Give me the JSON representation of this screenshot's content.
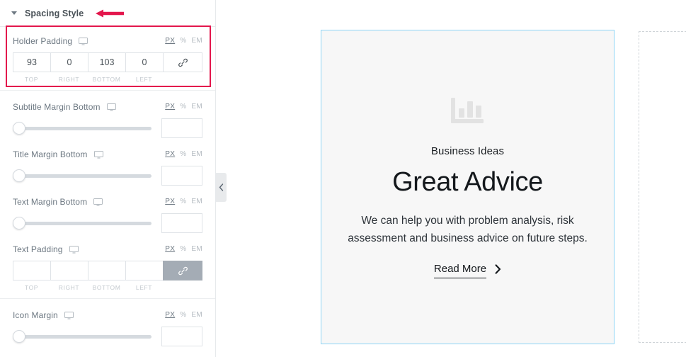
{
  "panel": {
    "title": "Spacing Style",
    "caret_icon": "caret-down-icon",
    "annotation_icon": "left-arrow-annotation-icon",
    "highlight_color": "#e3164c"
  },
  "units": {
    "px": "PX",
    "percent": "%",
    "em": "EM"
  },
  "dimension_labels": {
    "top": "TOP",
    "right": "RIGHT",
    "bottom": "BOTTOM",
    "left": "LEFT"
  },
  "controls": [
    {
      "label": "Holder Padding",
      "type": "dimensions",
      "device_icon": "desktop-monitor-icon",
      "active_unit": "PX",
      "highlighted": true,
      "link_active": false,
      "link_icon": "link-chain-icon",
      "values": {
        "top": "93",
        "right": "0",
        "bottom": "103",
        "left": "0"
      }
    },
    {
      "label": "Subtitle Margin Bottom",
      "type": "slider",
      "device_icon": "desktop-monitor-icon",
      "active_unit": "PX",
      "value": "",
      "slider_percent": 0
    },
    {
      "label": "Title Margin Bottom",
      "type": "slider",
      "device_icon": "desktop-monitor-icon",
      "active_unit": "PX",
      "value": "",
      "slider_percent": 0
    },
    {
      "label": "Text Margin Bottom",
      "type": "slider",
      "device_icon": "desktop-monitor-icon",
      "active_unit": "PX",
      "value": "",
      "slider_percent": 0
    },
    {
      "label": "Text Padding",
      "type": "dimensions",
      "device_icon": "desktop-monitor-icon",
      "active_unit": "PX",
      "highlighted": false,
      "link_active": true,
      "link_icon": "link-chain-icon",
      "values": {
        "top": "",
        "right": "",
        "bottom": "",
        "left": ""
      }
    },
    {
      "label": "Icon Margin",
      "type": "slider",
      "device_icon": "desktop-monitor-icon",
      "active_unit": "PX",
      "value": "",
      "slider_percent": 0
    }
  ],
  "collapse_tab": {
    "icon": "chevron-left-icon"
  },
  "canvas": {
    "card": {
      "icon": "bar-chart-icon",
      "subtitle": "Business Ideas",
      "title": "Great Advice",
      "text": "We can help you with problem analysis, risk assessment and business advice on future steps.",
      "link_label": "Read More",
      "link_icon": "chevron-right-icon",
      "border_color": "#8ed5f5",
      "background_color": "#f7f7f7"
    },
    "placeholder": {
      "name": "empty-column-placeholder"
    }
  }
}
